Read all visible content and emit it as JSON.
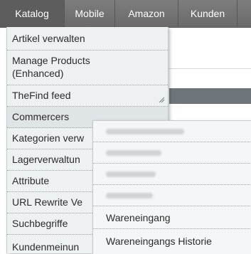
{
  "topnav": {
    "items": [
      {
        "label": "Katalog"
      },
      {
        "label": "Mobile"
      },
      {
        "label": "Amazon"
      },
      {
        "label": "Kunden"
      }
    ]
  },
  "catalog_menu": {
    "items": [
      {
        "label": "Artikel verwalten"
      },
      {
        "label": "Manage Products"
      },
      {
        "label": "(Enhanced)"
      },
      {
        "label": "TheFind feed"
      },
      {
        "label": "Commercers"
      },
      {
        "label": "Kategorien verw"
      },
      {
        "label": "Lagerverwaltun"
      },
      {
        "label": "Attribute"
      },
      {
        "label": "URL Rewrite Ve"
      },
      {
        "label": "Suchbegriffe"
      },
      {
        "label": "Kundenmeinun"
      }
    ]
  },
  "commercers_submenu": {
    "items": [
      {
        "label": "Wareneingang"
      },
      {
        "label": "Wareneingangs Historie"
      }
    ]
  },
  "colors": {
    "nav_bg": "#727272",
    "menu_bg": "#eef1f2",
    "highlight_strip": "#6e757a"
  }
}
